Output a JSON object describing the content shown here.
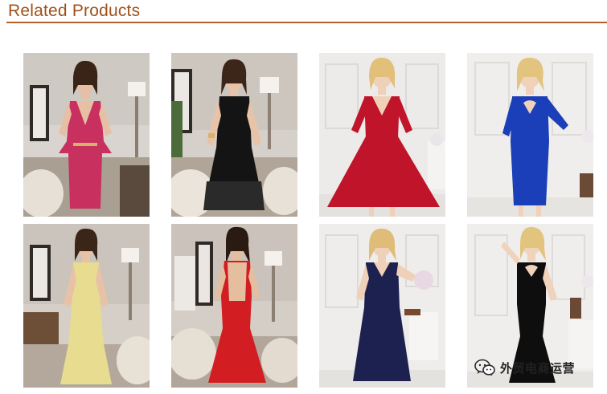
{
  "section": {
    "title": "Related Products"
  },
  "products": [
    {
      "name": "pink-peplum-dress-product",
      "dress": "#c8305f",
      "bg": "room"
    },
    {
      "name": "black-lace-dress-product",
      "dress": "#141414",
      "bg": "room"
    },
    {
      "name": "red-lace-dress-product",
      "dress": "#c0142a",
      "bg": "white"
    },
    {
      "name": "blue-lace-dress-product",
      "dress": "#1b3fb8",
      "bg": "white"
    },
    {
      "name": "yellow-gown-product",
      "dress": "#e8dc90",
      "bg": "room"
    },
    {
      "name": "red-gown-product",
      "dress": "#d21e22",
      "bg": "room"
    },
    {
      "name": "navy-lace-gown-product",
      "dress": "#1c2150",
      "bg": "white"
    },
    {
      "name": "black-gown-product",
      "dress": "#0e0e0e",
      "bg": "white"
    }
  ],
  "watermark": {
    "text": "外贸电商运营",
    "icon": "wechat-icon"
  }
}
